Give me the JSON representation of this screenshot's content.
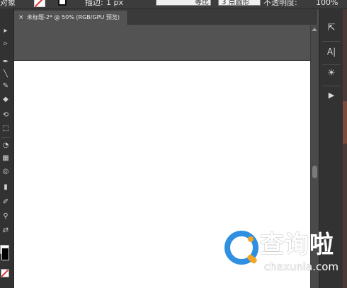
{
  "control_bar": {
    "object_label": "对象",
    "stroke_label": "描边:",
    "stroke_weight": "1 px",
    "uniform_label": "等比",
    "brush_label": "3 点圆形",
    "opacity_label": "不透明度:",
    "opacity_value": "100%"
  },
  "document_tab": {
    "close_glyph": "×",
    "title": "未标题-2* @ 50% (RGB/GPU 预览)"
  },
  "tools": [
    {
      "name": "selection-tool",
      "glyph": "▸"
    },
    {
      "name": "direct-selection-tool",
      "glyph": "▹"
    },
    {
      "name": "pen-tool",
      "glyph": "✒"
    },
    {
      "name": "line-tool",
      "glyph": "╲"
    },
    {
      "name": "brush-tool",
      "glyph": "✎"
    },
    {
      "name": "shaper-tool",
      "glyph": "◆"
    },
    {
      "name": "rotate-tool",
      "glyph": "⟲"
    },
    {
      "name": "free-transform-tool",
      "glyph": "⬚"
    },
    {
      "name": "shape-builder-tool",
      "glyph": "◔"
    },
    {
      "name": "mesh-tool",
      "glyph": "▦"
    },
    {
      "name": "blend-tool",
      "glyph": "◎"
    },
    {
      "name": "column-graph-tool",
      "glyph": "▮"
    },
    {
      "name": "eyedropper-tool",
      "glyph": "✐"
    },
    {
      "name": "zoom-tool",
      "glyph": "⚲"
    },
    {
      "name": "swap-fill-stroke",
      "glyph": "⇄"
    }
  ],
  "right_panel": [
    {
      "name": "export-panel-icon",
      "glyph": "⇱"
    },
    {
      "name": "character-panel-icon",
      "glyph": "A|"
    },
    {
      "name": "appearance-panel-icon",
      "glyph": "☀"
    },
    {
      "name": "actions-panel-icon",
      "glyph": "▶"
    }
  ],
  "watermark": {
    "chinese": "查询啦",
    "domain": "chaxunla.com"
  },
  "colors": {
    "canvas_bg": "#535353",
    "panel_bg": "#323232",
    "artboard": "#ffffff",
    "watermark_q": "#2f8fe0"
  }
}
